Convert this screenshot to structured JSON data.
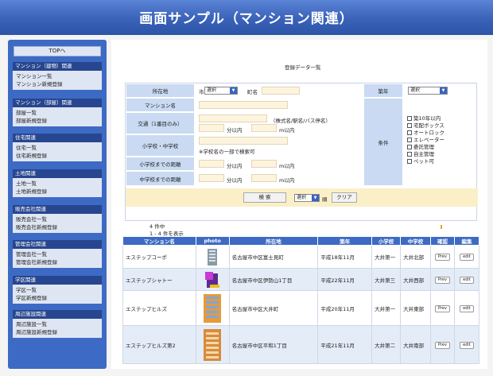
{
  "banner": {
    "title": "画面サンプル（マンション関連）"
  },
  "sidebar": {
    "top_link": "TOPへ",
    "groups": [
      {
        "head": "マンション（建物）関連",
        "items": [
          "マンション一覧",
          "マンション新規登録"
        ]
      },
      {
        "head": "マンション（部屋）関連",
        "items": [
          "部屋一覧",
          "部屋新規登録"
        ]
      },
      {
        "head": "住宅関連",
        "items": [
          "住宅一覧",
          "住宅新規登録"
        ]
      },
      {
        "head": "土地関連",
        "items": [
          "土地一覧",
          "土地新規登録"
        ]
      },
      {
        "head": "販売会社関連",
        "items": [
          "販売会社一覧",
          "販売会社新規登録"
        ]
      },
      {
        "head": "管理会社関連",
        "items": [
          "管理会社一覧",
          "管理会社新規登録"
        ]
      },
      {
        "head": "学区関連",
        "items": [
          "学区一覧",
          "学区新規登録"
        ]
      },
      {
        "head": "周辺施設関連",
        "items": [
          "周辺施設一覧",
          "周辺施設新規登録"
        ]
      }
    ]
  },
  "page": {
    "heading": "登録データ一覧"
  },
  "form": {
    "location_label": "所在地",
    "pref_prefix": "市",
    "city_select": "選択",
    "town_label": "町名",
    "building_age_label": "築年",
    "building_age_select": "選択",
    "mansion_name_label": "マンション名",
    "transport_label": "交通（1番目のみ）",
    "transport_hint": "（株式名/駅名/バス停名）",
    "walk_unit": "分以内",
    "distance_unit": "m以内",
    "school_label": "小学校・中学校",
    "school_hint": "※学校名の一部で検索可",
    "elementary_distance_label": "小学校までの距離",
    "junior_distance_label": "中学校までの距離",
    "conditions_label": "条件",
    "conditions": [
      "築10年以内",
      "宅配ボックス",
      "オートロック",
      "エレベーター",
      "委託管理",
      "自主管理",
      "ペット可"
    ],
    "search_button": "検 索",
    "sort_select": "選択",
    "sort_suffix": "順",
    "clear_button": "クリア"
  },
  "results": {
    "total": "4 件中",
    "range": "1 - 4 件を表示",
    "headers": [
      "マンション名",
      "photo",
      "所在地",
      "築年",
      "小学校",
      "中学校",
      "確認",
      "編集"
    ],
    "prev_label": "Prev",
    "edit_label": "edit",
    "rows": [
      {
        "name": "エステップコーポ",
        "address": "名古屋市中区富士見町",
        "year": "平成18年11月",
        "elementary": "大井第一",
        "junior": "大井北部"
      },
      {
        "name": "エステップシャトー",
        "address": "名古屋市中区伊勢山1丁目",
        "year": "平成22年11月",
        "elementary": "大井第三",
        "junior": "大井西部"
      },
      {
        "name": "エステップヒルズ",
        "address": "名古屋市中区大井町",
        "year": "平成20年11月",
        "elementary": "大井第一",
        "junior": "大井東部"
      },
      {
        "name": "エステップヒルズ第2",
        "address": "名古屋市中区平和1丁目",
        "year": "平成21年11月",
        "elementary": "大井第二",
        "junior": "大井南部"
      }
    ]
  }
}
